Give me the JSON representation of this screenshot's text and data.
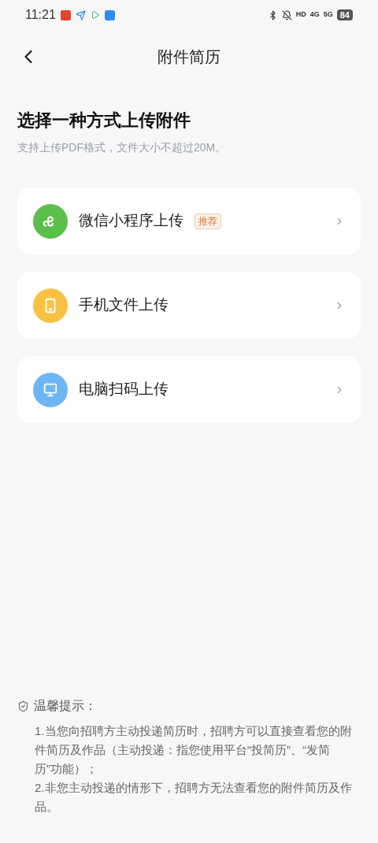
{
  "status_bar": {
    "time": "11:21",
    "network_labels": [
      "HD",
      "4G",
      "5G"
    ],
    "battery": "84"
  },
  "header": {
    "title": "附件简历"
  },
  "intro": {
    "heading": "选择一种方式上传附件",
    "subtitle": "支持上传PDF格式，文件大小不超过20M。"
  },
  "options": [
    {
      "kind": "miniprogram",
      "label": "微信小程序上传",
      "badge": "推荐",
      "color": "#5bbf4b"
    },
    {
      "kind": "phone",
      "label": "手机文件上传",
      "color": "#f7c244"
    },
    {
      "kind": "computer",
      "label": "电脑扫码上传",
      "color": "#6cb6f5"
    }
  ],
  "tips": {
    "title": "温馨提示：",
    "items": [
      "1.当您向招聘方主动投递简历时，招聘方可以直接查看您的附件简历及作品（主动投递：指您使用平台“投简历”、“发简历”功能）；",
      "2.非您主动投递的情形下，招聘方无法查看您的附件简历及作品。"
    ]
  }
}
